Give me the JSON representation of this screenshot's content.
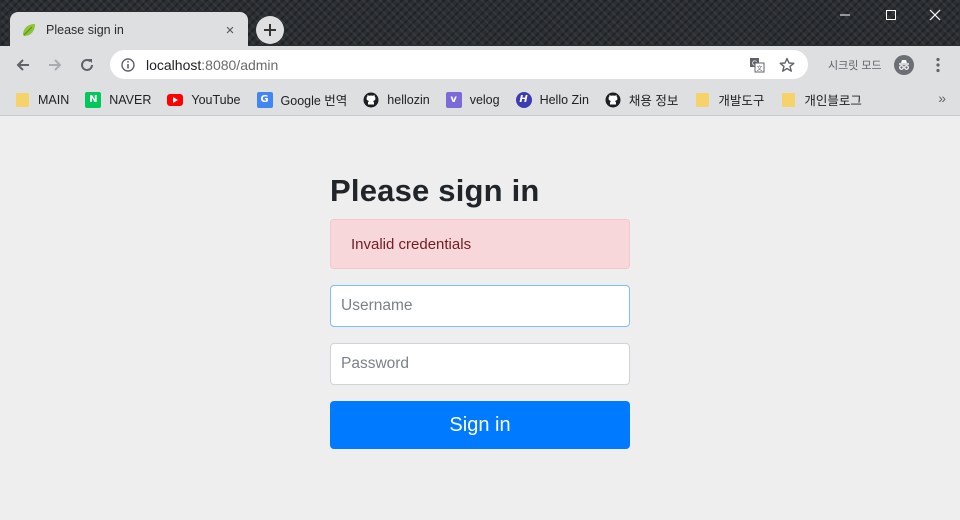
{
  "window": {
    "tab_title": "Please sign in",
    "new_tab_symbol": "+",
    "close_symbol": "×"
  },
  "toolbar": {
    "url_host": "localhost",
    "url_rest": ":8080/admin",
    "incognito_label": "시크릿 모드"
  },
  "bookmarks": [
    {
      "label": "MAIN",
      "icon": "folder-icon"
    },
    {
      "label": "NAVER",
      "icon": "naver-icon",
      "glyph": "N",
      "color": "#03c75a"
    },
    {
      "label": "YouTube",
      "icon": "youtube-icon",
      "color": "#ff0000"
    },
    {
      "label": "Google 번역",
      "icon": "google-translate-icon",
      "glyph": "G",
      "color": "#4285f4"
    },
    {
      "label": "hellozin",
      "icon": "github-icon"
    },
    {
      "label": "velog",
      "icon": "velog-icon",
      "glyph": "v",
      "color": "#7c6ad9"
    },
    {
      "label": "Hello Zin",
      "icon": "hashnode-icon",
      "glyph": "H",
      "color": "#3b3bb3"
    },
    {
      "label": "채용 정보",
      "icon": "github-icon"
    },
    {
      "label": "개발도구",
      "icon": "folder-icon"
    },
    {
      "label": "개인블로그",
      "icon": "folder-icon"
    }
  ],
  "bookmarks_more": "»",
  "form": {
    "heading": "Please sign in",
    "error": "Invalid credentials",
    "username_placeholder": "Username",
    "password_placeholder": "Password",
    "submit_label": "Sign in"
  },
  "colors": {
    "primary": "#007bff",
    "alert_bg": "#f8d7da",
    "alert_text": "#721c24"
  }
}
